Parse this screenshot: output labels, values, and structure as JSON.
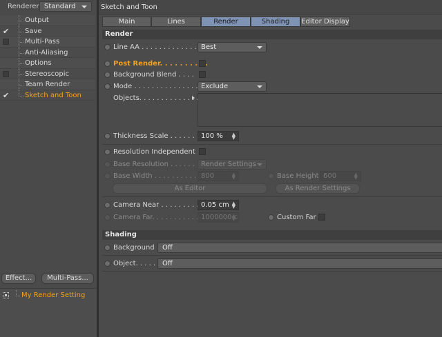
{
  "left": {
    "renderer_label": "Renderer",
    "renderer_value": "Standard",
    "tree": [
      {
        "label": "Output",
        "check": "none"
      },
      {
        "label": "Save",
        "check": "tick"
      },
      {
        "label": "Multi-Pass",
        "check": "box"
      },
      {
        "label": "Anti-Aliasing",
        "check": "none"
      },
      {
        "label": "Options",
        "check": "none"
      },
      {
        "label": "Stereoscopic",
        "check": "box"
      },
      {
        "label": "Team Render",
        "check": "none"
      },
      {
        "label": "Sketch and Toon",
        "check": "tick",
        "active": true
      }
    ],
    "effect_button": "Effect...",
    "multipass_button": "Multi-Pass...",
    "render_setting": "My Render Setting"
  },
  "right": {
    "title": "Sketch and Toon",
    "tabs": [
      "Main",
      "Lines",
      "Render",
      "Shading",
      "Editor Display"
    ],
    "selected_tabs": [
      "Render",
      "Shading"
    ],
    "render_section": "Render",
    "line_aa": {
      "label": "Line AA . . . . . . . . . . . . . .",
      "value": "Best"
    },
    "post_render": {
      "label": "Post Render. . . . . . . . . ."
    },
    "background_blend": {
      "label": "Background Blend . . . ."
    },
    "mode": {
      "label": "Mode . . . . . . . . . . . . . . . .",
      "value": "Exclude"
    },
    "objects": {
      "label": "Objects. . . . . . . . . . . . . ."
    },
    "thickness_scale": {
      "label": "Thickness Scale . . . . . . . .",
      "value": "100 %"
    },
    "resolution_independent": {
      "label": "Resolution Independent"
    },
    "base_resolution": {
      "label": "Base Resolution . . . . . . .",
      "value": "Render Settings"
    },
    "base_width": {
      "label": "Base Width . . . . . . . . . . .",
      "value": "800"
    },
    "base_height": {
      "label": "Base Height",
      "value": "600"
    },
    "as_editor": "As Editor",
    "as_render_settings": "As Render Settings",
    "camera_near": {
      "label": "Camera Near . . . . . . . . . .",
      "value": "0.05 cm"
    },
    "camera_far": {
      "label": "Camera Far. . . . . . . . . . .",
      "value": "1000000 c"
    },
    "custom_far": {
      "label": "Custom Far"
    },
    "shading_section": "Shading",
    "background": {
      "label": "Background",
      "value": "Off"
    },
    "object": {
      "label": "Object. . . . .",
      "value": "Off"
    }
  }
}
